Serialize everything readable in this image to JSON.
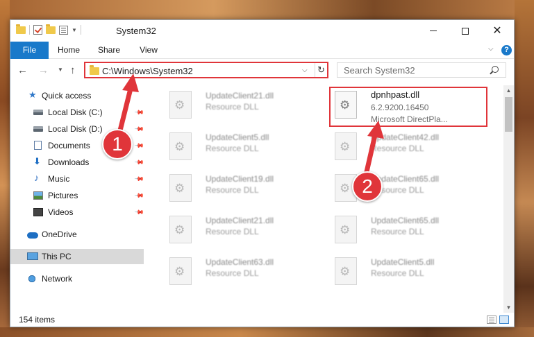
{
  "window": {
    "title": "System32",
    "controls": {
      "minimize": "—",
      "maximize": "□",
      "close": "✕"
    }
  },
  "ribbon": {
    "tabs": [
      "File",
      "Home",
      "Share",
      "View"
    ],
    "help": "?"
  },
  "address": {
    "path": "C:\\Windows\\System32",
    "search_placeholder": "Search System32"
  },
  "nav": {
    "items": [
      {
        "label": "Quick access",
        "icon": "star-icon"
      },
      {
        "label": "Local Disk (C:)",
        "icon": "disk-icon",
        "pinned": true
      },
      {
        "label": "Local Disk (D:)",
        "icon": "disk-icon",
        "pinned": true
      },
      {
        "label": "Documents",
        "icon": "documents-icon",
        "pinned": true
      },
      {
        "label": "Downloads",
        "icon": "downloads-icon",
        "pinned": true
      },
      {
        "label": "Music",
        "icon": "music-icon",
        "pinned": true
      },
      {
        "label": "Pictures",
        "icon": "pictures-icon",
        "pinned": true
      },
      {
        "label": "Videos",
        "icon": "videos-icon",
        "pinned": true
      },
      {
        "label": "OneDrive",
        "icon": "onedrive-icon"
      },
      {
        "label": "This PC",
        "icon": "this-pc-icon",
        "selected": true
      },
      {
        "label": "Network",
        "icon": "network-icon"
      }
    ]
  },
  "files": {
    "left": [
      {
        "name": "UpdateClient21.dll",
        "type": "Resource DLL"
      },
      {
        "name": "UpdateClient5.dll",
        "type": "Resource DLL"
      },
      {
        "name": "UpdateClient19.dll",
        "type": "Resource DLL"
      },
      {
        "name": "UpdateClient21.dll",
        "type": "Resource DLL"
      },
      {
        "name": "UpdateClient63.dll",
        "type": "Resource DLL"
      }
    ],
    "highlighted": {
      "name": "dpnhpast.dll",
      "version": "6.2.9200.16450",
      "description": "Microsoft DirectPla..."
    },
    "right": [
      {
        "name": "UpdateClient42.dll",
        "type": "Resource DLL"
      },
      {
        "name": "UpdateClient65.dll",
        "type": "Resource DLL"
      },
      {
        "name": "UpdateClient65.dll",
        "type": "Resource DLL"
      },
      {
        "name": "UpdateClient5.dll",
        "type": "Resource DLL"
      }
    ]
  },
  "status": {
    "item_count": "154 items"
  },
  "annotations": {
    "badge1": "1",
    "badge2": "2",
    "color": "#e0353a"
  },
  "colors": {
    "accent": "#1979ca",
    "highlight": "#e0353a"
  }
}
